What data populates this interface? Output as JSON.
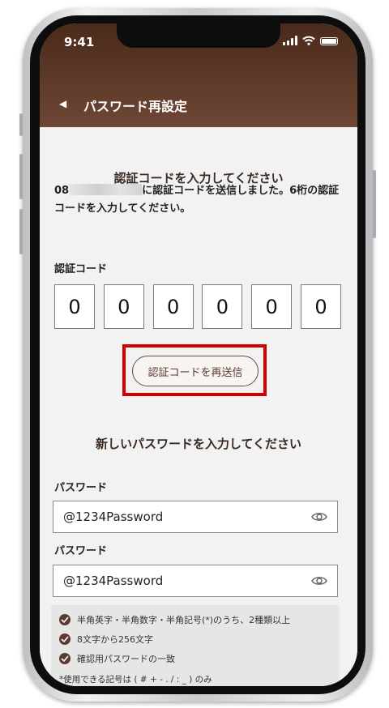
{
  "status_bar": {
    "time": "9:41"
  },
  "header": {
    "title": "パスワード再設定",
    "back_icon": "back-triangle-icon"
  },
  "verification": {
    "heading": "認証コードを入力してください",
    "phone_prefix": "08",
    "description_rest": "に認証コードを送信しました。6桁の認証コードを入力してください。",
    "code_label": "認証コード",
    "digits": [
      "0",
      "0",
      "0",
      "0",
      "0",
      "0"
    ],
    "resend_label": "認証コードを再送信"
  },
  "new_password": {
    "heading": "新しいパスワードを入力してください",
    "field1_label": "パスワード",
    "field1_value": "@1234Password",
    "field2_label": "パスワード",
    "field2_value": "@1234Password"
  },
  "rules": {
    "items": [
      "半角英字・半角数字・半角記号(*)のうち、2種類以上",
      "8文字から256文字",
      "確認用パスワードの一致"
    ],
    "note": "*使用できる記号は ( # + - . / : _ ) のみ"
  },
  "colors": {
    "header_top": "#4a2a1a",
    "header_bottom": "#6e4735",
    "accent": "#5a3a2e",
    "highlight": "#d40000"
  }
}
